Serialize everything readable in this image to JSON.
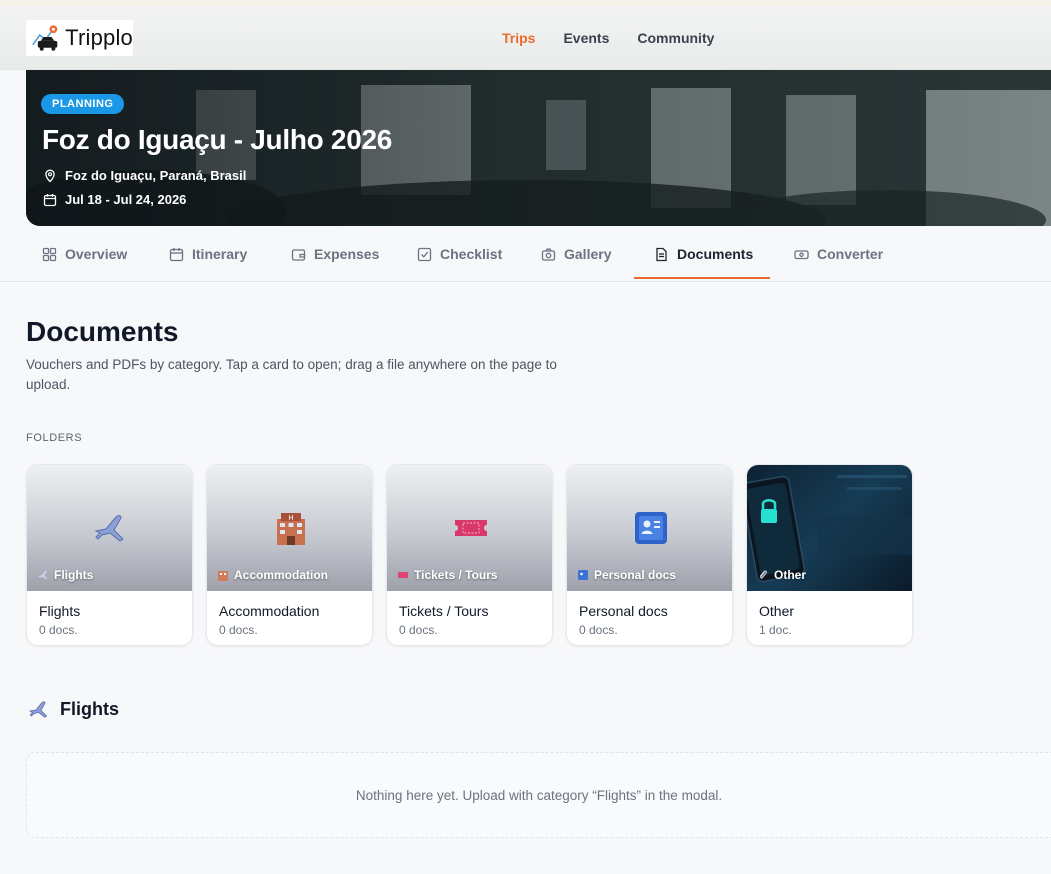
{
  "header": {
    "logo_text": "Tripplo",
    "nav": [
      {
        "label": "Trips",
        "active": true
      },
      {
        "label": "Events",
        "active": false
      },
      {
        "label": "Community",
        "active": false
      }
    ]
  },
  "hero": {
    "badge": "PLANNING",
    "title": "Foz do Iguaçu - Julho 2026",
    "location": "Foz do Iguaçu, Paraná, Brasil",
    "dates": "Jul 18 - Jul 24, 2026"
  },
  "tabs": [
    {
      "label": "Overview",
      "icon": "grid-icon"
    },
    {
      "label": "Itinerary",
      "icon": "calendar-icon"
    },
    {
      "label": "Expenses",
      "icon": "wallet-icon"
    },
    {
      "label": "Checklist",
      "icon": "checkbox-icon"
    },
    {
      "label": "Gallery",
      "icon": "camera-icon"
    },
    {
      "label": "Documents",
      "icon": "document-icon",
      "active": true
    },
    {
      "label": "Converter",
      "icon": "money-icon"
    }
  ],
  "page": {
    "title": "Documents",
    "subtitle": "Vouchers and PDFs by category. Tap a card to open; drag a file anywhere on the page to upload.",
    "folders_label": "FOLDERS"
  },
  "folders": [
    {
      "tag": "Flights",
      "name": "Flights",
      "count": "0 docs.",
      "icon": "airplane-icon"
    },
    {
      "tag": "Accommodation",
      "name": "Accommodation",
      "count": "0 docs.",
      "icon": "hotel-icon"
    },
    {
      "tag": "Tickets / Tours",
      "name": "Tickets / Tours",
      "count": "0 docs.",
      "icon": "ticket-icon"
    },
    {
      "tag": "Personal docs",
      "name": "Personal docs",
      "count": "0 docs.",
      "icon": "id-card-icon"
    },
    {
      "tag": "Other",
      "name": "Other",
      "count": "1 doc.",
      "icon": "paperclip-icon"
    }
  ],
  "section": {
    "title": "Flights",
    "empty_text": "Nothing here yet. Upload with category “Flights” in the modal."
  },
  "colors": {
    "accent": "#ec6a2c",
    "badge": "#1a98e5"
  }
}
